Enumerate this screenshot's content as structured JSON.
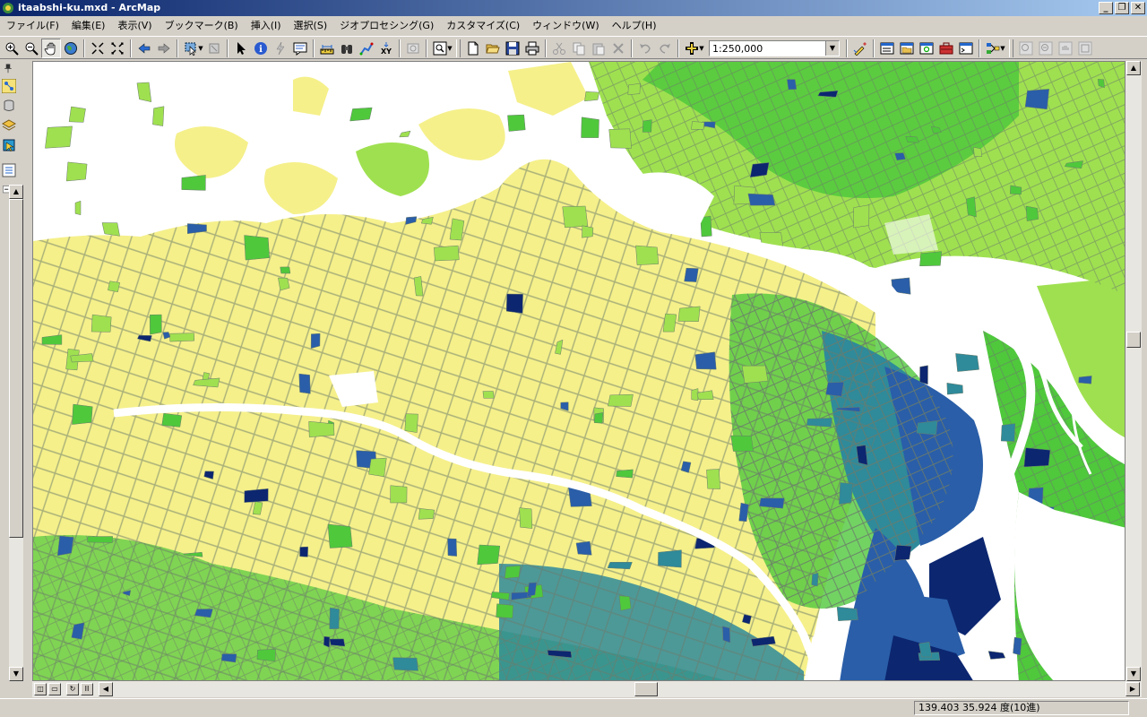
{
  "window": {
    "title": "itaabshi-ku.mxd - ArcMap"
  },
  "menu": {
    "items": [
      "ファイル(F)",
      "編集(E)",
      "表示(V)",
      "ブックマーク(B)",
      "挿入(I)",
      "選択(S)",
      "ジオプロセシング(G)",
      "カスタマイズ(C)",
      "ウィンドウ(W)",
      "ヘルプ(H)"
    ]
  },
  "toolbar": {
    "scale_value": "1:250,000"
  },
  "status": {
    "coordinates": "139.403  35.924 度(10進)"
  },
  "colors": {
    "yellow": "#f5f08a",
    "light_green": "#9fe050",
    "green": "#4fc83c",
    "teal": "#2f8a9a",
    "blue": "#2a5ea8",
    "navy": "#0c2670",
    "road": "#6b7b6b",
    "river": "#ffffff"
  }
}
